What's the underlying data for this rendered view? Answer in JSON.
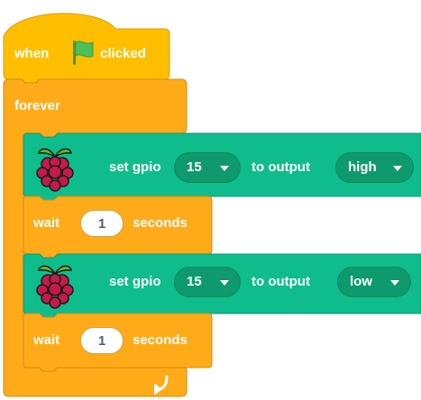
{
  "hat": {
    "when_label": "when",
    "clicked_label": "clicked",
    "flag_icon": "green-flag-icon"
  },
  "forever": {
    "label": "forever",
    "loop_icon": "loop-arrow-icon"
  },
  "gpio_blocks": [
    {
      "set_label": "set gpio",
      "pin_value": "15",
      "to_output_label": "to output",
      "output_value": "high"
    },
    {
      "set_label": "set gpio",
      "pin_value": "15",
      "to_output_label": "to output",
      "output_value": "low"
    }
  ],
  "wait_blocks": [
    {
      "wait_label": "wait",
      "seconds_value": "1",
      "seconds_label": "seconds"
    },
    {
      "wait_label": "wait",
      "seconds_value": "1",
      "seconds_label": "seconds"
    }
  ],
  "colors": {
    "events": "#ffbf00",
    "control": "#ffab19",
    "extension": "#0fbd8c",
    "flag": "#4cbf56"
  }
}
